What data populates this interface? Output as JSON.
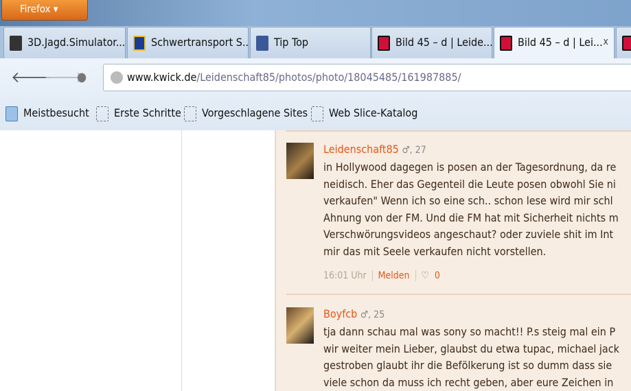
{
  "browser": {
    "menu_button": "Firefox ▾",
    "tabs": [
      {
        "label": "3D.Jagd.Simulator...",
        "color": "#333"
      },
      {
        "label": "Schwertransport S...",
        "color": "#1a3a9a"
      },
      {
        "label": "Tip Top",
        "color": "#3b5998"
      },
      {
        "label": "Bild 45 – d | Leide...",
        "color": "#d0103a"
      },
      {
        "label": "Bild 45 – d | Lei...",
        "color": "#d0103a",
        "active": true
      },
      {
        "label": "",
        "color": "#d0103a"
      }
    ],
    "close_tab": "x",
    "url_domain": "www.kwick.de",
    "url_path": "/Leidenschaft85/photos/photo/18045485/161987885/",
    "bookmarks": [
      "Meistbesucht",
      "Erste Schritte",
      "Vorgeschlagene Sites",
      "Web Slice-Katalog"
    ]
  },
  "comments": [
    {
      "user": "Leidenschaft85",
      "meta": "♂, 27",
      "lines": [
        "in Hollywood dagegen is posen an der Tagesordnung, da re",
        "neidisch. Eher das Gegenteil die Leute posen obwohl Sie ni",
        "verkaufen\" Wenn ich so eine sch.. schon lese wird mir schl",
        "Ahnung von der FM. Und die FM hat mit Sicherheit nichts m",
        "Verschwörungsvideos angeschaut? oder zuviele shit im Int",
        "mir das mit Seele verkaufen nicht vorstellen."
      ],
      "time": "16:01 Uhr",
      "report": "Melden",
      "heart": "♡",
      "likes": "0"
    },
    {
      "user": "Boyfcb",
      "meta": "♂, 25",
      "lines": [
        "tja dann schau mal was sony so macht!! P.s steig mal ein P",
        "wir weiter mein Lieber, glaubst du etwa tupac, michael jack",
        "gestroben glaubt ihr die Beföl­kerung ist so dumm dass sie",
        "viele schon da muss ich recht geben, aber eure Zeichen in"
      ]
    }
  ]
}
